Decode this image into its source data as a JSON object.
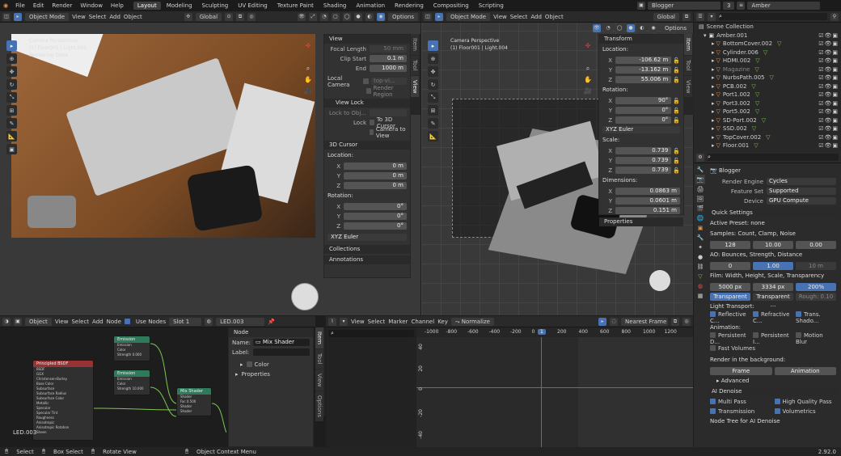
{
  "app": {
    "menus": [
      "File",
      "Edit",
      "Render",
      "Window",
      "Help"
    ],
    "workspaces": [
      "Layout",
      "Modeling",
      "Sculpting",
      "UV Editing",
      "Texture Paint",
      "Shading",
      "Animation",
      "Rendering",
      "Compositing",
      "Scripting"
    ],
    "scene": "Blogger",
    "scene_users": "3",
    "view_layer": "Amber",
    "version": "2.92.0"
  },
  "left_vp": {
    "mode": "Object Mode",
    "menus": [
      "View",
      "Select",
      "Add",
      "Object"
    ],
    "orientation": "Global",
    "options": "Options",
    "overlay_title": "Camera Perspective",
    "overlay_object": "(1) Floor001 | Light.001",
    "overlay_status": "Rendering Done"
  },
  "npanel_left": {
    "tabs": [
      "Item",
      "Tool",
      "View"
    ],
    "view_header": "View",
    "focal_label": "Focal Length",
    "focal": "50 mm",
    "clip_start_label": "Clip Start",
    "clip_start": "0.1 m",
    "end_label": "End",
    "end": "1000 m",
    "local_camera_label": "Local Camera",
    "local_camera": "top-vi...",
    "render_region": "Render Region",
    "view_lock_header": "View Lock",
    "lock_to_obj": "Lock to Obj...",
    "lock_label": "Lock",
    "to_3d_cursor": "To 3D Cursor",
    "camera_to_view": "Camera to View",
    "cursor_header": "3D Cursor",
    "location_label": "Location:",
    "rotation_label": "Rotation:",
    "x": "X",
    "y": "Y",
    "z": "Z",
    "loc": [
      "0 m",
      "0 m",
      "0 m"
    ],
    "rot": [
      "0°",
      "0°",
      "0°"
    ],
    "rot_mode": "XYZ Euler",
    "collections": "Collections",
    "annotations": "Annotations"
  },
  "right_vp": {
    "mode": "Object Mode",
    "menus": [
      "View",
      "Select",
      "Add",
      "Object"
    ],
    "orientation": "Global",
    "options": "Options",
    "overlay_title": "Camera Perspective",
    "overlay_object": "(1) Floor001 | Light.004"
  },
  "npanel_right": {
    "tabs": [
      "Item",
      "Tool",
      "View"
    ],
    "header": "Transform",
    "location_label": "Location:",
    "loc": [
      "-106.62 m",
      "-13.162 m",
      "55.006 m"
    ],
    "rotation_label": "Rotation:",
    "rot": [
      "90°",
      "0°",
      "0°"
    ],
    "rot_mode": "XYZ Euler",
    "scale_label": "Scale:",
    "scale": [
      "0.739",
      "0.739",
      "0.739"
    ],
    "dimensions_label": "Dimensions:",
    "dim": [
      "0.0863 m",
      "0.0601 m",
      "0.151 m"
    ],
    "properties": "Properties",
    "x": "X",
    "y": "Y",
    "z": "Z"
  },
  "outliner": {
    "scene_collection": "Scene Collection",
    "root": "Amber.001",
    "items": [
      "BottomCover.002",
      "Cylinder.006",
      "HDMI.002",
      "Magazine",
      "NurbsPath.005",
      "PCB.002",
      "Port1.002",
      "Port3.002",
      "Port5.002",
      "SD-Port.002",
      "SSD.002",
      "TopCover.002",
      "Floor.001"
    ]
  },
  "props": {
    "scene_name": "Blogger",
    "render_engine_label": "Render Engine",
    "render_engine": "Cycles",
    "feature_set_label": "Feature Set",
    "feature_set": "Supported",
    "device_label": "Device",
    "device": "GPU Compute",
    "quick_settings": "Quick Settings",
    "active_preset": "Active Preset: none",
    "samples_label": "Samples: Count, Clamp, Noise",
    "samples": [
      "128",
      "10.00",
      "0.00"
    ],
    "ao_label": "AO: Bounces, Strength, Distance",
    "ao": [
      "0",
      "1.00",
      "10 m"
    ],
    "film_label": "Film: Width, Height, Scale, Transparency",
    "film": [
      "5000 px",
      "3334 px",
      "200%"
    ],
    "transparent": "Transparent",
    "transparent2": "Transparent ...",
    "rough": "Rough: 0.10",
    "light_transport": "Light Transport:",
    "refl1": "Reflective C...",
    "refl2": "Refractive C...",
    "trans_shadow": "Trans. Shado...",
    "animation_label": "Animation:",
    "persistent1": "Persistent D...",
    "persistent2": "Persistent I...",
    "motion_blur": "Motion Blur",
    "fast_volumes": "Fast Volumes",
    "render_bg": "Render in the background:",
    "frame_btn": "Frame",
    "animation_btn": "Animation",
    "advanced": "Advanced",
    "ai_denoise": "AI Denoise",
    "multi_pass": "Multi Pass",
    "high_quality": "High Quality Pass",
    "transmission": "Transmission",
    "volumetrics": "Volumetrics",
    "node_tree": "Node Tree for AI Denoise"
  },
  "node_editor": {
    "type": "Object",
    "menus": [
      "View",
      "Select",
      "Add",
      "Node"
    ],
    "use_nodes": "Use Nodes",
    "slot": "Slot 1",
    "material": "LED.003",
    "object_label": "LED.003",
    "tabs": [
      "Item",
      "Tool",
      "View",
      "Options"
    ],
    "node_header": "Node",
    "name_label": "Name:",
    "name_value": "Mix Shader",
    "label_label": "Label:",
    "color_label": "Color",
    "properties_label": "Properties",
    "nodes": [
      {
        "title": "Principled BSDF",
        "rows": [
          "BSDF",
          "GGX",
          "Christensen-Burley",
          "Base Color",
          "Subsurface",
          "Subsurface Radius",
          "Subsurface Color",
          "Metallic",
          "Specular",
          "Specular Tint",
          "Roughness",
          "Anisotropic",
          "Anisotropic Rotation",
          "Sheen"
        ]
      },
      {
        "title": "Emission",
        "rows": [
          "Emission",
          "Color",
          "Strength 0.000"
        ]
      },
      {
        "title": "Emission",
        "rows": [
          "Emission",
          "Color",
          "Strength 10.000"
        ]
      },
      {
        "title": "Mix Shader",
        "rows": [
          "Shader",
          "Fac 0.500",
          "Shader",
          "Shader"
        ]
      }
    ]
  },
  "graph": {
    "menus": [
      "View",
      "Select",
      "Marker",
      "Channel",
      "Key"
    ],
    "normalize": "Normalize",
    "interp": "Nearest Frame",
    "ruler": [
      "-1000",
      "-800",
      "-600",
      "-400",
      "-200",
      "0",
      "1",
      "200",
      "400",
      "600",
      "800",
      "1000",
      "1200"
    ],
    "current_frame": "1",
    "yticks": [
      "40",
      "20",
      "0",
      "-20",
      "-40"
    ]
  },
  "status": {
    "select": "Select",
    "box_select": "Box Select",
    "rotate_view": "Rotate View",
    "context_menu": "Object Context Menu"
  }
}
